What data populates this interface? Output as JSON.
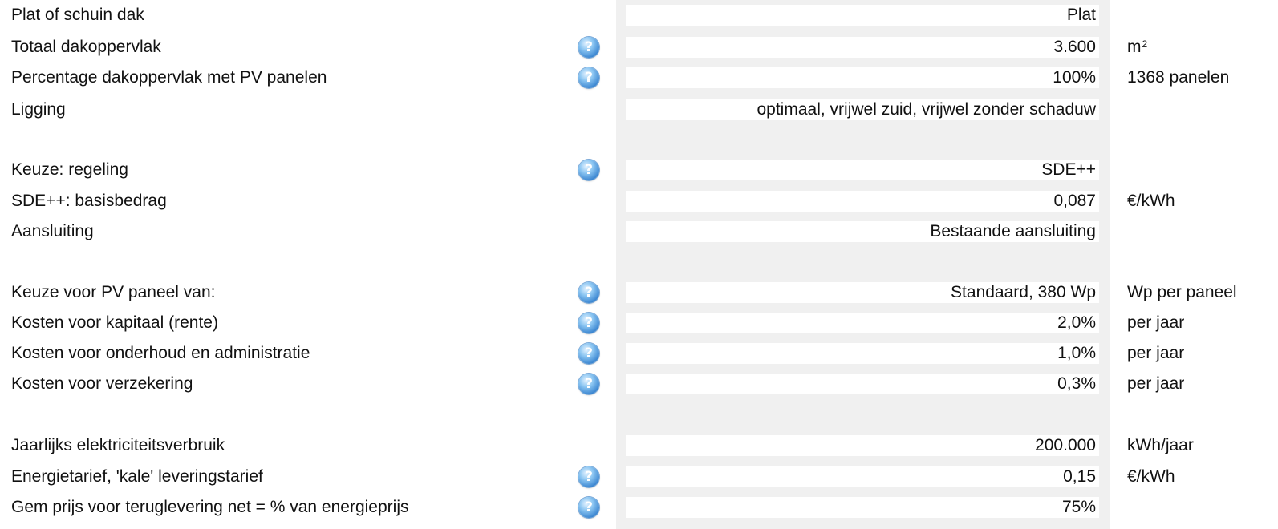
{
  "rows": [
    {
      "label": "Plat of schuin dak",
      "value": "Plat",
      "unit": ""
    },
    {
      "label": "Totaal dakoppervlak",
      "value": "3.600",
      "unit": "m",
      "unit_sup": "2"
    },
    {
      "label": "Percentage dakoppervlak met PV panelen",
      "value": "100%",
      "unit": "1368 panelen"
    },
    {
      "label": "Ligging",
      "value": "optimaal, vrijwel zuid, vrijwel zonder schaduw",
      "unit": ""
    },
    {
      "label": "Keuze: regeling",
      "value": "SDE++",
      "unit": ""
    },
    {
      "label": "SDE++: basisbedrag",
      "value": "0,087",
      "unit": "€/kWh"
    },
    {
      "label": "Aansluiting",
      "value": "Bestaande aansluiting",
      "unit": ""
    },
    {
      "label": "Keuze voor PV paneel van:",
      "value": "Standaard, 380 Wp",
      "unit": "Wp per paneel"
    },
    {
      "label": "Kosten voor kapitaal (rente)",
      "value": "2,0%",
      "unit": "per jaar"
    },
    {
      "label": "Kosten voor onderhoud en administratie",
      "value": "1,0%",
      "unit": "per jaar"
    },
    {
      "label": "Kosten voor verzekering",
      "value": "0,3%",
      "unit": "per jaar"
    },
    {
      "label": "Jaarlijks elektriciteitsverbruik",
      "value": "200.000",
      "unit": "kWh/jaar"
    },
    {
      "label": "Energietarief, 'kale' leveringstarief",
      "value": "0,15",
      "unit": "€/kWh"
    },
    {
      "label": "Gem prijs voor teruglevering net = % van energieprijs",
      "value": "75%",
      "unit": ""
    }
  ],
  "help_glyph": "?",
  "help_icon": "question-help-icon",
  "colors": {
    "input_panel_bg": "#f0f0f0",
    "input_field_bg": "#ffffff",
    "help_icon_blue": "#3b86d1"
  }
}
